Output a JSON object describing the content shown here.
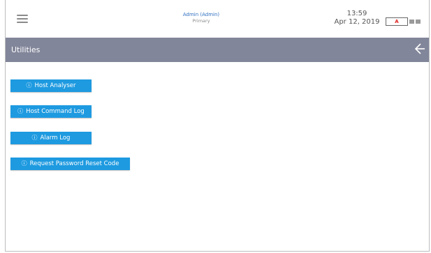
{
  "header": {
    "user_name": "Admin (Admin)",
    "user_role": "Primary",
    "time": "13:59",
    "date": "Apr 12, 2019",
    "alarm_letter": "A"
  },
  "page": {
    "title": "Utilities"
  },
  "buttons": [
    {
      "label": "Host Analyser",
      "icon": "info-circle-icon"
    },
    {
      "label": "Host Command Log",
      "icon": "info-circle-icon"
    },
    {
      "label": "Alarm Log",
      "icon": "info-circle-icon"
    },
    {
      "label": "Request Password Reset Code",
      "icon": "info-circle-icon"
    }
  ],
  "colors": {
    "accent": "#1e9ae0",
    "titlebar": "#82869a",
    "user_text": "#2f6fc0",
    "alarm": "#e02020"
  }
}
